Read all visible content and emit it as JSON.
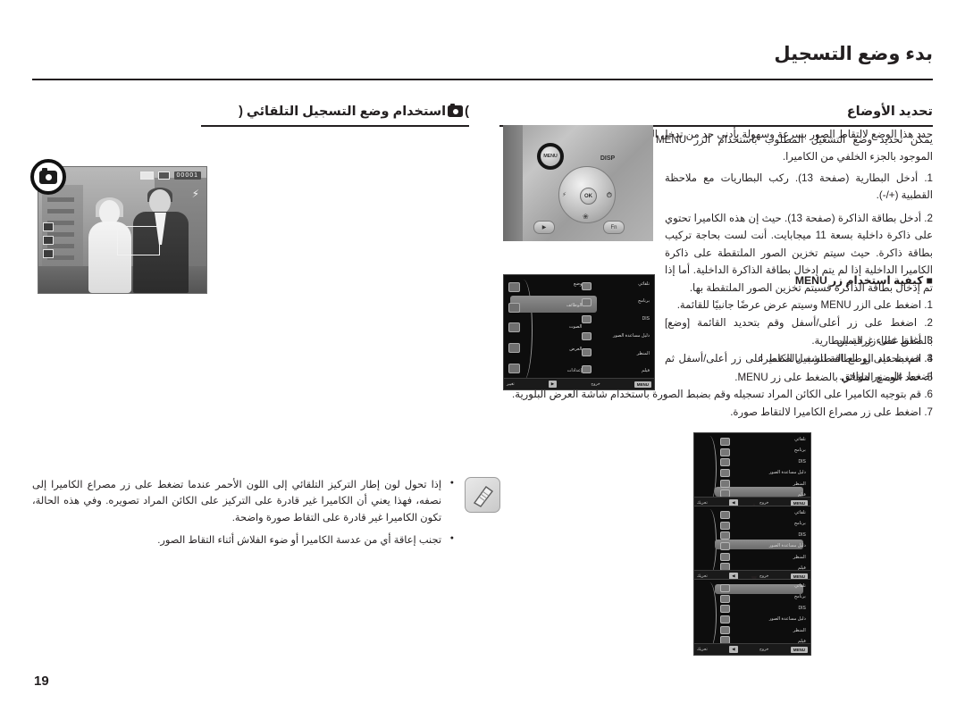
{
  "header": {
    "title": "بدء وضع التسجيل"
  },
  "page_number": "19",
  "left_column": {
    "section_heading_before": "استخدام وضع التسجيل التلقائي (",
    "section_heading_after": ")",
    "intro": "حدد هذا الوضع لالتقاط الصور بسرعة وسهولة بأدنى حد من تدخل المستخدم.",
    "steps": [
      "1. أدخل البطارية (صفحة 13). ركب البطاريات مع ملاحظة القطبية (+/-).",
      "2. أدخل بطاقة الذاكرة (صفحة 13). حيث إن هذه الكاميرا تحتوي على ذاكرة داخلية بسعة 11 ميجابايت. أنت لست بحاجة تركيب بطاقة ذاكرة. حيث سيتم تخزين الصور الملتقطة على ذاكرة الكاميرا الداخلية إذا لم يتم إدخال بطاقة الذاكرة الداخلية. أما إذا تم إدخال بطاقة الذاكرة فسيتم تخزين الصور الملتقطة بها.",
      "3. أغلق غطاء غرفة البطارية.",
      "4. اضغط على زر الطاقة لتشغيل الكاميرا.",
      "5. حدد الوضع التلقائي بالضغط على زر MENU.",
      "6. قم بتوجيه الكاميرا على الكائن المراد تسجيله وقم بضبط الصورة باستخدام شاشة العرض البلورية.",
      "7. اضغط على زر مصراع الكاميرا لالتقاط صورة."
    ],
    "notes": [
      "إذا تحول لون إطار التركيز التلقائي إلى اللون الأحمر عندما تضغط على زر مصراع الكاميرا إلى نصفه، فهذا يعني أن الكاميرا غير قادرة على التركيز على الكائن المراد تصويره. وفي هذه الحالة، تكون الكاميرا غير قادرة على التقاط صورة واضحة.",
      "تجنب إعاقة أي من عدسة الكاميرا أو ضوء الفلاش أثناء التقاط الصور."
    ],
    "lcd_osd": {
      "counter": "00001",
      "flash": "4",
      "icons": [
        "counter-badge",
        "card-icon",
        "battery-icon"
      ]
    }
  },
  "right_column": {
    "section_heading": "تحديد الأوضاع",
    "intro": "يمكن تحديد وضع التشغيل المطلوب باستخدام الزر MENU الموجود بالجزء الخلفي من الكاميرا.",
    "subheading": "■ كيفية استخدام زر MENU",
    "steps": [
      "1. اضغط على الزر MENU وسيتم عرض عرضًا جانبيًا للقائمة.",
      "2. اضغط على زر أعلى/أسفل وقم بتحديد القائمة [وضع] بالضغط على زر اليمين.",
      "3. قم بتحديد الوضع المطلوب بالضغط على زر أعلى/أسفل ثم اضغط على زر موافق."
    ],
    "camera_back_buttons": {
      "menu": "MENU",
      "disp": "DISP",
      "ok": "OK",
      "up": "",
      "left": "⚡",
      "down": "❀",
      "right": "⏱",
      "play": "▶",
      "fn": "Fn"
    },
    "menu_screen_main": {
      "left_labels": [
        "وضع",
        "الوظائف",
        "الصوت",
        "العرض",
        "إعدادات"
      ],
      "right_labels": [
        "تلقائي",
        "برنامج",
        "DIS",
        "دليل مساعدة الصور",
        "المنظر",
        "فيلم"
      ],
      "selected_left": "وضع",
      "bottom_back": "خروج",
      "bottom_move": "تغيير"
    },
    "menu_screens_sub": [
      {
        "labels": [
          "تلقائي",
          "برنامج",
          "DIS",
          "دليل مساعدة الصور",
          "المنظر",
          "فيلم"
        ],
        "selected_index": 5,
        "bottom_back": "خروج",
        "bottom_move": "تحريك"
      },
      {
        "labels": [
          "تلقائي",
          "برنامج",
          "DIS",
          "دليل مساعدة الصور",
          "المنظر",
          "فيلم"
        ],
        "selected_index": 3,
        "bottom_back": "خروج",
        "bottom_move": "تحريك"
      },
      {
        "labels": [
          "تلقائي",
          "برنامج",
          "DIS",
          "دليل مساعدة الصور",
          "المنظر",
          "فيلم"
        ],
        "selected_index": 0,
        "bottom_back": "خروج",
        "bottom_move": "تحريك"
      }
    ],
    "arrows": [
      "▲",
      "▼"
    ]
  }
}
